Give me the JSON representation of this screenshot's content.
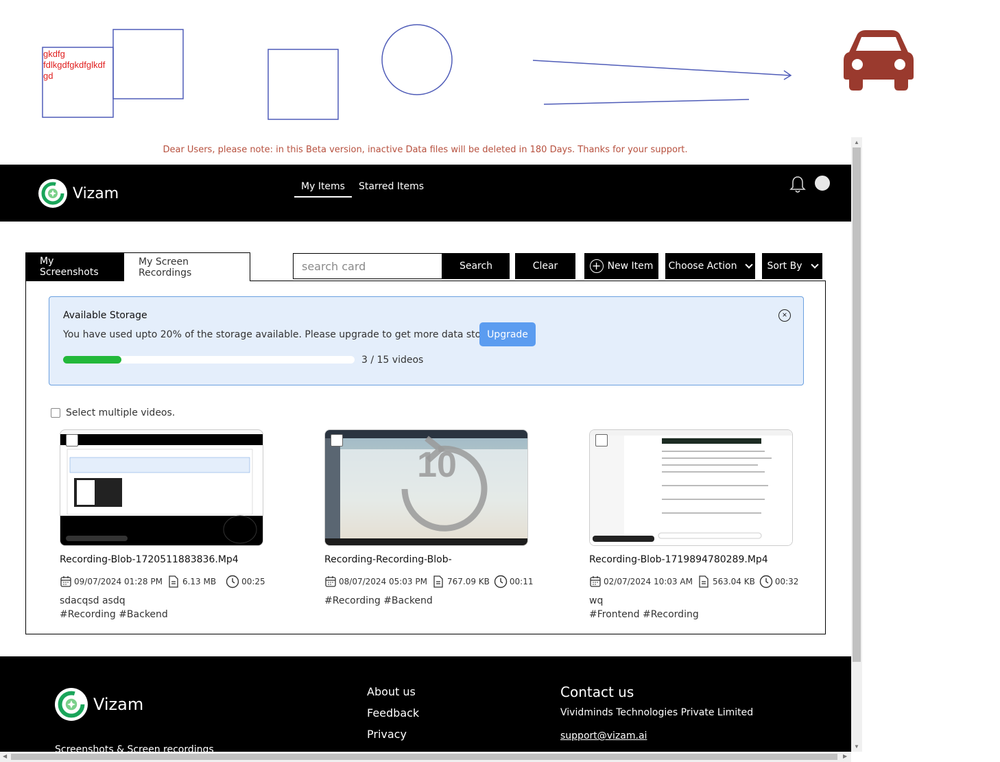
{
  "annotation": {
    "text_lines": [
      "gkdfg",
      "fdlkgdfgkdfglkdf",
      "gd"
    ],
    "stroke_color": "#4f5cb8",
    "text_color": "#e02020",
    "car_color": "#9a3a2e"
  },
  "notice": "Dear Users, please note: in this Beta version, inactive Data files will be deleted in 180 Days. Thanks for your support.",
  "header": {
    "brand": "Vizam",
    "nav": [
      {
        "label": "My Items",
        "active": true
      },
      {
        "label": "Starred Items",
        "active": false
      }
    ],
    "icons": [
      "bell-icon",
      "avatar"
    ]
  },
  "tabs": [
    {
      "label": "My Screenshots",
      "active": false
    },
    {
      "label": "My Screen Recordings",
      "active": true
    }
  ],
  "toolbar": {
    "search_placeholder": "search card",
    "search_label": "Search",
    "clear_label": "Clear",
    "new_label": "New Item",
    "action_label": "Choose Action",
    "sort_label": "Sort By"
  },
  "storage": {
    "title": "Available Storage",
    "message": "You have used upto 20% of the storage available. Please upgrade to get more data storage.",
    "upgrade_label": "Upgrade",
    "used_fraction": 0.2,
    "count_text": "3  /  15  videos",
    "accent": "#22b83a"
  },
  "select_multiple_label": "Select multiple videos.",
  "cards": [
    {
      "name": "Recording-Blob-1720511883836.Mp4",
      "date": "09/07/2024 01:28 PM",
      "size": "6.13 MB",
      "duration": "00:25",
      "description": "sdacqsd asdq",
      "tags": "#Recording #Backend"
    },
    {
      "name": "Recording-Recording-Blob-",
      "date": "08/07/2024 05:03 PM",
      "size": "767.09 KB",
      "duration": "00:11",
      "description": "",
      "tags": "#Recording #Backend",
      "overlay": "10"
    },
    {
      "name": "Recording-Blob-1719894780289.Mp4",
      "date": "02/07/2024 10:03 AM",
      "size": "563.04 KB",
      "duration": "00:32",
      "description": "wq",
      "tags": "#Frontend #Recording"
    }
  ],
  "footer": {
    "brand": "Vizam",
    "tagline": "Screenshots & Screen recordings",
    "links": [
      "About us",
      "Feedback",
      "Privacy"
    ],
    "contact_heading": "Contact us",
    "company": "Vividminds Technologies Private Limited",
    "email": "support@vizam.ai"
  }
}
